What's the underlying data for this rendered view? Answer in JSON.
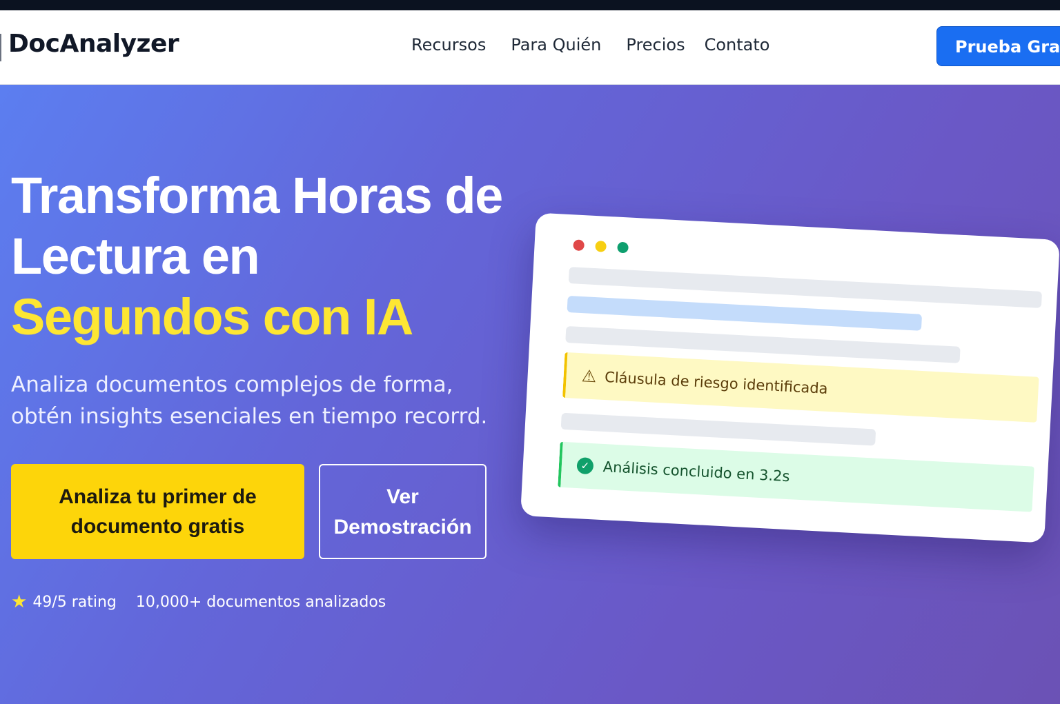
{
  "brand": {
    "name": "DocAnalyzer"
  },
  "nav": {
    "links": [
      "Recursos",
      "Para Quién",
      "Precios",
      "Contato"
    ],
    "cta_label": "Prueba Gratis"
  },
  "hero": {
    "headline_part1": "Transforma Horas de Lectura en ",
    "headline_highlight": "Segundos con IA",
    "subtitle": "Analiza documentos complejos de forma, obtén insights esenciales en tiempo recorrd.",
    "primary_button": "Analiza tu primer de documento gratis",
    "secondary_button": "Ver Demostración",
    "stats": {
      "rating": "49/5 rating",
      "documents": "10,000+ documentos analizados"
    }
  },
  "mockup": {
    "warning_text": "Cláusula de riesgo identificada",
    "success_text": "Análisis concluido en 3.2s"
  },
  "colors": {
    "accent_yellow": "#fde633",
    "cta_blue": "#1a6ef2",
    "button_yellow": "#fdd50a",
    "hero_gradient_start": "#5c7ef0",
    "hero_gradient_end": "#6b52b5"
  },
  "icons": {
    "star": "star-icon",
    "warning": "warning-icon",
    "success": "check-circle-icon"
  }
}
